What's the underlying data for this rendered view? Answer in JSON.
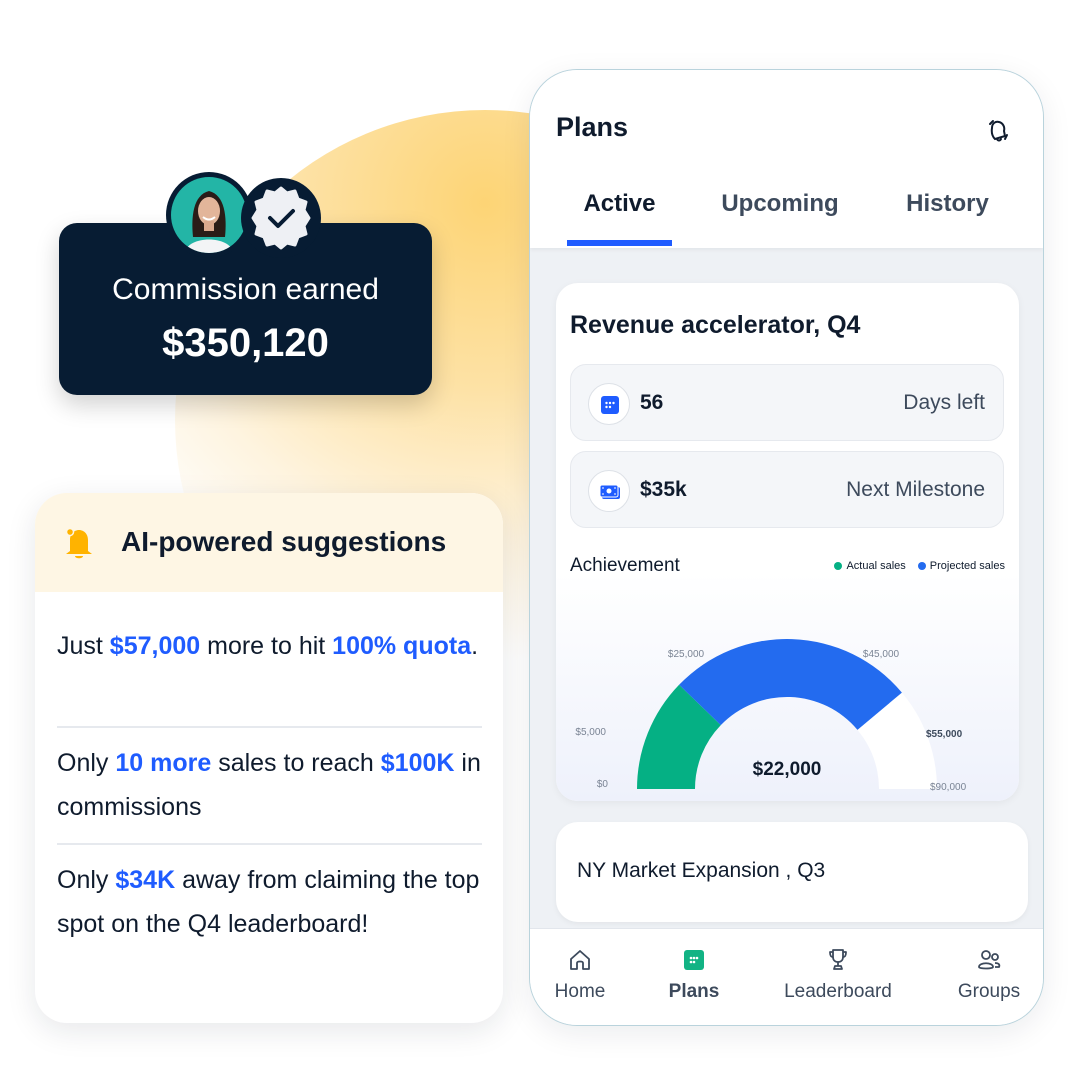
{
  "colors": {
    "accent_blue": "#1f5cff",
    "actual_green": "#05b084",
    "projected_blue": "#236bef",
    "navy": "#071c33",
    "amber": "#ffb300"
  },
  "commission": {
    "label": "Commission earned",
    "value": "$350,120",
    "avatar_icon": "person-avatar",
    "badge_icon": "verified-badge-icon"
  },
  "ai_suggestions": {
    "title": "AI-powered suggestions",
    "icon": "bell-icon",
    "items": [
      {
        "parts": [
          {
            "t": "Just ",
            "h": false
          },
          {
            "t": "$57,000",
            "h": true
          },
          {
            "t": " more to hit ",
            "h": false
          },
          {
            "t": "100% quota",
            "h": true
          },
          {
            "t": ".",
            "h": false
          }
        ]
      },
      {
        "parts": [
          {
            "t": "Only ",
            "h": false
          },
          {
            "t": "10 more",
            "h": true
          },
          {
            "t": " sales to reach ",
            "h": false
          },
          {
            "t": "$100K",
            "h": true
          },
          {
            "t": " in commissions",
            "h": false
          }
        ]
      },
      {
        "parts": [
          {
            "t": "Only ",
            "h": false
          },
          {
            "t": "$34K",
            "h": true
          },
          {
            "t": " away from claiming the top spot on the Q4 leaderboard!",
            "h": false
          }
        ]
      }
    ]
  },
  "phone": {
    "title": "Plans",
    "notification_icon": "bell-off-icon",
    "tabs": [
      {
        "label": "Active",
        "active": true
      },
      {
        "label": "Upcoming",
        "active": false
      },
      {
        "label": "History",
        "active": false
      }
    ],
    "plan": {
      "title": "Revenue accelerator, Q4",
      "stats": [
        {
          "icon": "calendar-icon",
          "value": "56",
          "label": "Days left"
        },
        {
          "icon": "money-icon",
          "value": "$35k",
          "label": "Next Milestone"
        }
      ],
      "achievement_title": "Achievement"
    },
    "next_plan": {
      "title": "NY Market Expansion , Q3"
    },
    "nav": [
      {
        "label": "Home",
        "icon": "home-icon",
        "active": false
      },
      {
        "label": "Plans",
        "icon": "plans-icon",
        "active": true
      },
      {
        "label": "Leaderboard",
        "icon": "trophy-icon",
        "active": false
      },
      {
        "label": "Groups",
        "icon": "groups-icon",
        "active": false
      }
    ]
  },
  "chart_data": {
    "type": "gauge",
    "title": "Achievement",
    "center_label": "$22,000",
    "range": [
      0,
      90000
    ],
    "legend": [
      "Actual sales",
      "Projected sales"
    ],
    "legend_position": "top-right",
    "series": [
      {
        "name": "Actual sales",
        "from": 0,
        "to": 22000,
        "color": "#05b084"
      },
      {
        "name": "Projected sales",
        "from": 22000,
        "to": 70000,
        "color": "#236bef"
      }
    ],
    "tick_labels": [
      {
        "label": "$0",
        "value": 0,
        "bold": false
      },
      {
        "label": "$5,000",
        "value": 5000,
        "bold": false
      },
      {
        "label": "$25,000",
        "value": 25000,
        "bold": false
      },
      {
        "label": "$45,000",
        "value": 45000,
        "bold": false
      },
      {
        "label": "$55,000",
        "value": 55000,
        "bold": true
      },
      {
        "label": "$90,000",
        "value": 90000,
        "bold": false
      }
    ]
  }
}
